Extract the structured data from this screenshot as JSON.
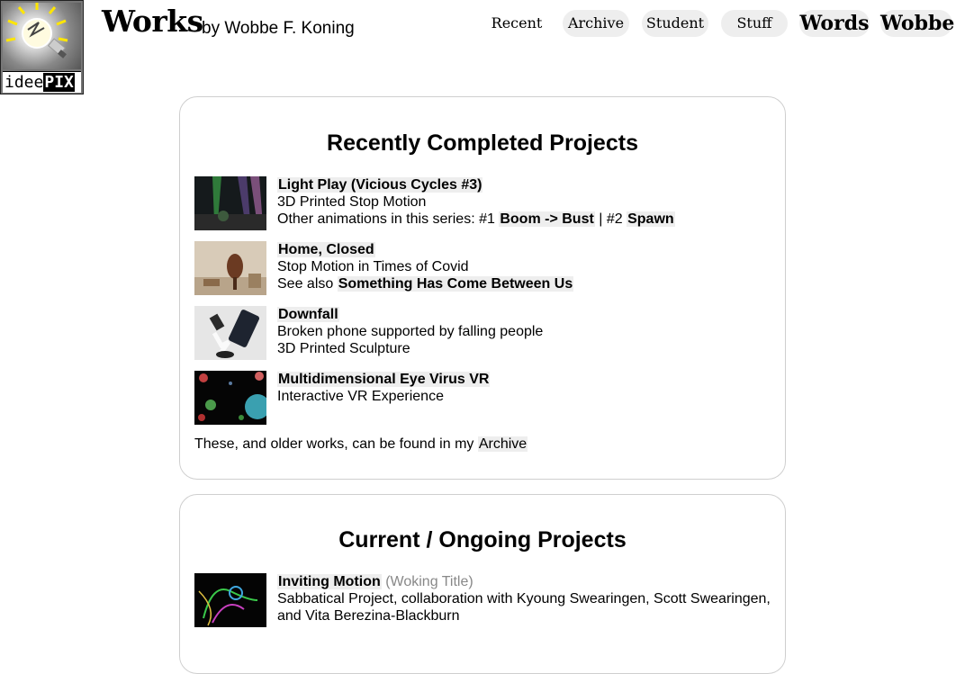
{
  "header": {
    "logo_text_left": "idee",
    "logo_text_right": "PIX",
    "site_title": "Works",
    "byline": "by Wobbe F. Koning"
  },
  "nav": {
    "items": [
      "Recent",
      "Archive",
      "Student",
      "Stuff",
      "Words",
      "Wobbe"
    ]
  },
  "recent": {
    "heading": "Recently Completed Projects",
    "projects": [
      {
        "title": "Light Play (Vicious Cycles #3)",
        "line2": "3D Printed Stop Motion",
        "line3_prefix": "Other animations in this series: #1",
        "line3_link1": "Boom -> Bust",
        "line3_sep": "| #2",
        "line3_link2": "Spawn"
      },
      {
        "title": "Home, Closed",
        "line2": "Stop Motion in Times of Covid",
        "line3_prefix": "See also",
        "line3_link1": "Something Has Come Between Us"
      },
      {
        "title": "Downfall",
        "line2": "Broken phone supported by falling people",
        "line3": "3D Printed Sculpture"
      },
      {
        "title": "Multidimensional Eye Virus VR",
        "line2": "Interactive VR Experience"
      }
    ],
    "footer_prefix": "These, and older works, can be found in my",
    "footer_link": "Archive"
  },
  "current": {
    "heading": "Current / Ongoing Projects",
    "projects": [
      {
        "title": "Inviting Motion",
        "subtitle": "(Woking Title)",
        "line2": "Sabbatical Project, collaboration with Kyoung Swearingen, Scott Swearingen,",
        "line3": "and Vita Berezina-Blackburn"
      }
    ]
  }
}
